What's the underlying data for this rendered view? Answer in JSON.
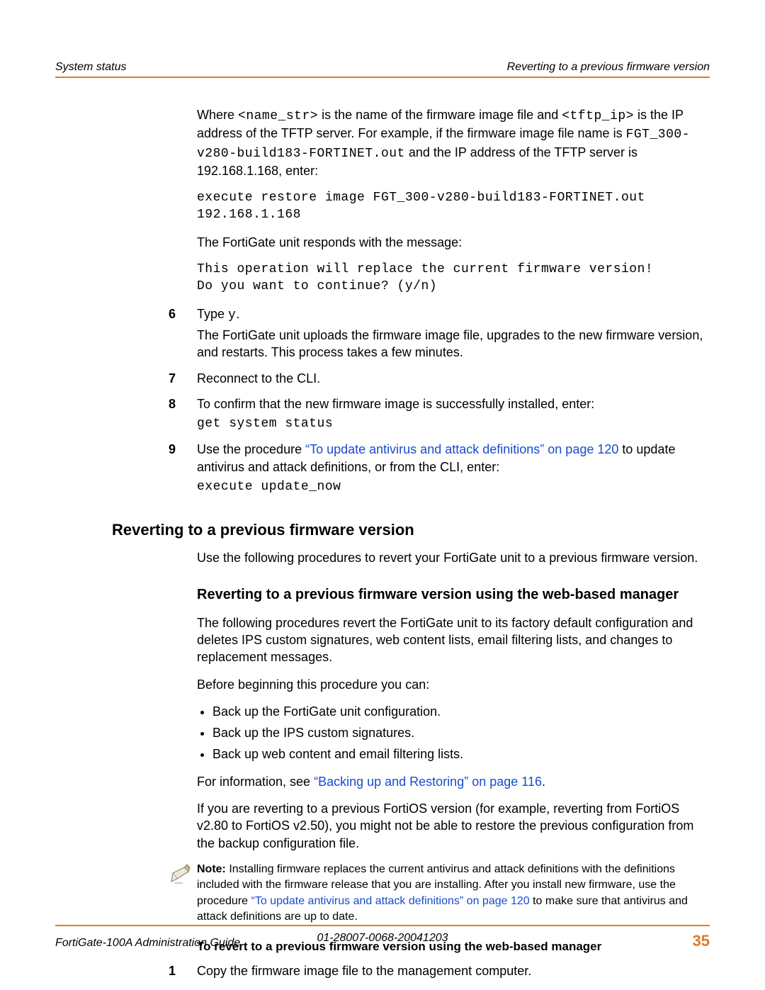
{
  "header": {
    "left": "System status",
    "right": "Reverting to a previous firmware version"
  },
  "intro": {
    "text_before_code1": "Where ",
    "code1": "<name_str>",
    "text_mid1": " is the name of the firmware image file and ",
    "code2": "<tftp_ip>",
    "text_after": " is the IP address of the TFTP server. For example, if the firmware image file name is ",
    "code3": "FGT_300-v280-build183-FORTINET.out",
    "text_end1": " and the IP address of the TFTP server is 192.168.1.168, enter:",
    "cmd1": "execute restore image FGT_300-v280-build183-FORTINET.out 192.168.1.168",
    "resp_label": "The FortiGate unit responds with the message:",
    "resp_msg": "This operation will replace the current firmware version!\nDo you want to continue? (y/n)"
  },
  "steps_a": {
    "s6_num": "6",
    "s6_a": "Type ",
    "s6_code": "y",
    "s6_b": ".",
    "s6_detail": "The FortiGate unit uploads the firmware image file, upgrades to the new firmware version, and restarts. This process takes a few minutes.",
    "s7_num": "7",
    "s7_text": "Reconnect to the CLI.",
    "s8_num": "8",
    "s8_text": "To confirm that the new firmware image is successfully installed, enter:",
    "s8_cmd": "get system status",
    "s9_num": "9",
    "s9_a": "Use the procedure ",
    "s9_link": "“To update antivirus and attack definitions” on page 120",
    "s9_b": " to update antivirus and attack definitions, or from the CLI, enter:",
    "s9_cmd": "execute update_now"
  },
  "section": {
    "h2": "Reverting to a previous firmware version",
    "intro": "Use the following procedures to revert your FortiGate unit to a previous firmware version.",
    "h3": "Reverting to a previous firmware version using the web-based manager",
    "p1": "The following procedures revert the FortiGate unit to its factory default configuration and deletes IPS custom signatures, web content lists, email filtering lists, and changes to replacement messages.",
    "p2": "Before beginning this procedure you can:",
    "bullets": [
      "Back up the FortiGate unit configuration.",
      "Back up the IPS custom signatures.",
      "Back up web content and email filtering lists."
    ],
    "p3a": "For information, see ",
    "p3link": "“Backing up and Restoring” on page 116",
    "p3b": ".",
    "p4": "If you are reverting to a previous FortiOS version (for example, reverting from FortiOS v2.80 to FortiOS v2.50), you might not be able to restore the previous configuration from the backup configuration file.",
    "note_label": "Note:",
    "note_a": " Installing firmware replaces the current antivirus and attack definitions with the definitions included with the firmware release that you are installing. After you install new firmware, use the procedure ",
    "note_link": "“To update antivirus and attack definitions” on page 120",
    "note_b": " to make sure that antivirus and attack definitions are up to date.",
    "h4": "To revert to a previous firmware version using the web-based manager",
    "s1_num": "1",
    "s1_text": "Copy the firmware image file to the management computer."
  },
  "footer": {
    "left": "FortiGate-100A Administration Guide",
    "center": "01-28007-0068-20041203",
    "page": "35"
  }
}
